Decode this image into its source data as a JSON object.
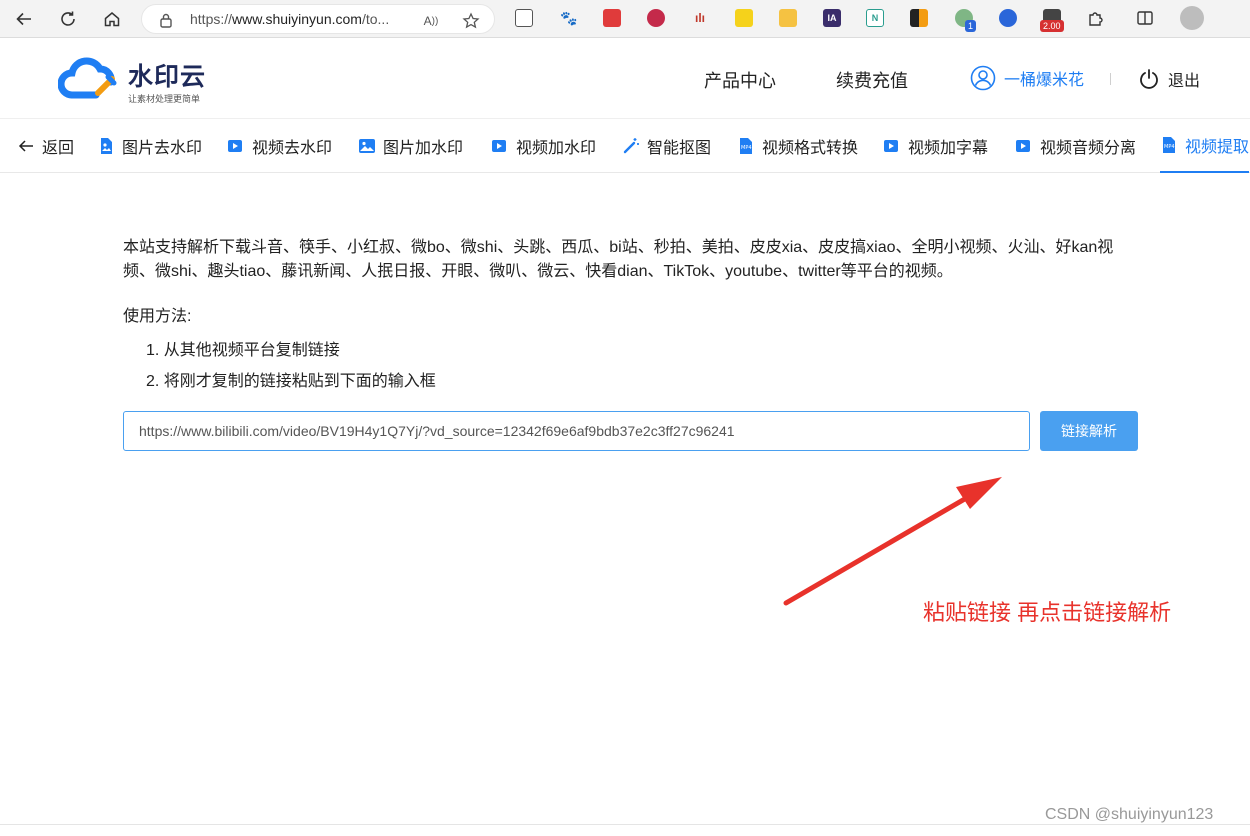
{
  "browser": {
    "url_prefix": "https://",
    "url_domain": "www.shuiyinyun.com",
    "url_rest": "/to...",
    "ext_badge_1": "1",
    "ext_badge_price": "2.00",
    "ext_ia_label": "IA",
    "ext_n_label": "N"
  },
  "header": {
    "logo_title": "水印云",
    "logo_subtitle": "让素材处理更简单",
    "nav": [
      {
        "label": "产品中心"
      },
      {
        "label": "续费充值"
      }
    ],
    "user_name": "一桶爆米花",
    "logout_label": "退出"
  },
  "tabs": [
    {
      "label": "返回"
    },
    {
      "label": "图片去水印"
    },
    {
      "label": "视频去水印"
    },
    {
      "label": "图片加水印"
    },
    {
      "label": "视频加水印"
    },
    {
      "label": "智能抠图"
    },
    {
      "label": "视频格式转换"
    },
    {
      "label": "视频加字幕"
    },
    {
      "label": "视频音频分离"
    },
    {
      "label": "视频提取"
    }
  ],
  "main": {
    "description": "本站支持解析下载斗音、筷手、小红叔、微bo、微shi、头跳、西瓜、bi站、秒拍、美拍、皮皮xia、皮皮搞xiao、全明小视频、火汕、好kan视频、微shi、趣头tiao、藤讯新闻、人抿日报、开眼、微叭、微云、快看dian、TikTok、youtube、twitter等平台的视频。",
    "usage_title": "使用方法:",
    "steps": [
      "1. 从其他视频平台复制链接",
      "2. 将刚才复制的链接粘贴到下面的输入框"
    ],
    "input_value": "https://www.bilibili.com/video/BV19H4y1Q7Yj/?vd_source=12342f69e6af9bdb37e2c3ff27c96241",
    "parse_button": "链接解析"
  },
  "annotation": {
    "text": "粘贴链接 再点击链接解析",
    "color": "#e8322b"
  },
  "watermark": "CSDN @shuiyinyun123",
  "colors": {
    "accent": "#1f7ef3",
    "button": "#4aa0f0"
  }
}
